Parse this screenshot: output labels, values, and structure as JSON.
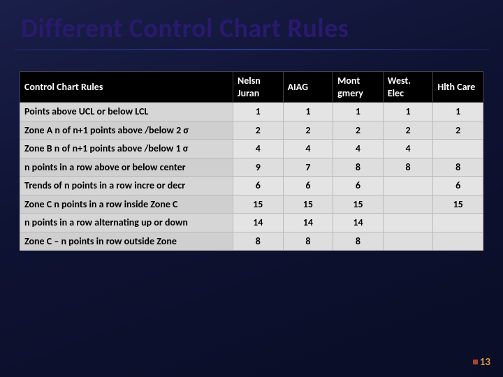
{
  "title": "Different Control Chart Rules",
  "header": {
    "rule_col": "Control Chart Rules",
    "cols": [
      "Nelsn Juran",
      "AIAG",
      "Mont gmery",
      "West. Elec",
      "Hlth Care"
    ]
  },
  "rows": [
    {
      "label": "Points above UCL or below LCL",
      "v": [
        "1",
        "1",
        "1",
        "1",
        "1"
      ]
    },
    {
      "label": "Zone A n of n+1 points above /below 2 σ",
      "v": [
        "2",
        "2",
        "2",
        "2",
        "2"
      ]
    },
    {
      "label": "Zone B n of n+1 points above /below 1 σ",
      "v": [
        "4",
        "4",
        "4",
        "4",
        ""
      ]
    },
    {
      "label": "n points in a row above or below center",
      "v": [
        "9",
        "7",
        "8",
        "8",
        "8"
      ]
    },
    {
      "label": "Trends of n points in a row incre or decr",
      "v": [
        "6",
        "6",
        "6",
        "",
        "6"
      ]
    },
    {
      "label": "Zone C n points in a row inside Zone C",
      "v": [
        "15",
        "15",
        "15",
        "",
        "15"
      ]
    },
    {
      "label": "n points in a row alternating up or down",
      "v": [
        "14",
        "14",
        "14",
        "",
        ""
      ]
    },
    {
      "label": "Zone C – n points in row outside Zone",
      "v": [
        "8",
        "8",
        "8",
        "",
        ""
      ]
    }
  ],
  "page_number": "13",
  "chart_data": {
    "type": "table",
    "title": "Different Control Chart Rules",
    "columns": [
      "Rule",
      "Nelsn Juran",
      "AIAG",
      "Montgmery",
      "West. Elec",
      "Hlth Care"
    ],
    "data": [
      [
        "Points above UCL or below LCL",
        1,
        1,
        1,
        1,
        1
      ],
      [
        "Zone A n of n+1 points above/below 2σ",
        2,
        2,
        2,
        2,
        2
      ],
      [
        "Zone B n of n+1 points above/below 1σ",
        4,
        4,
        4,
        4,
        null
      ],
      [
        "n points in a row above or below center",
        9,
        7,
        8,
        8,
        8
      ],
      [
        "Trends of n points in a row incre or decr",
        6,
        6,
        6,
        null,
        6
      ],
      [
        "Zone C n points in a row inside Zone C",
        15,
        15,
        15,
        null,
        15
      ],
      [
        "n points in a row alternating up or down",
        14,
        14,
        14,
        null,
        null
      ],
      [
        "Zone C – n points in row outside Zone",
        8,
        8,
        8,
        null,
        null
      ]
    ]
  }
}
